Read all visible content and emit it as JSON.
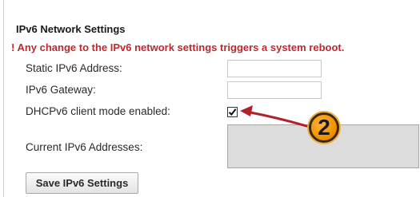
{
  "section_title": "IPv6 Network Settings",
  "warning": "! Any change to the IPv6 network settings triggers a system reboot.",
  "fields": {
    "static_address": {
      "label": "Static IPv6 Address:",
      "value": ""
    },
    "gateway": {
      "label": "IPv6 Gateway:",
      "value": ""
    },
    "dhcp": {
      "label": "DHCPv6 client mode enabled:",
      "checked": true,
      "checkmark": "✔"
    },
    "current_addresses": {
      "label": "Current IPv6 Addresses:",
      "value": ""
    }
  },
  "save_button": {
    "label": "Save IPv6 Settings"
  },
  "annotation": {
    "step_number": "2",
    "color_arrow": "#b0222a",
    "color_badge": "#f29400"
  }
}
